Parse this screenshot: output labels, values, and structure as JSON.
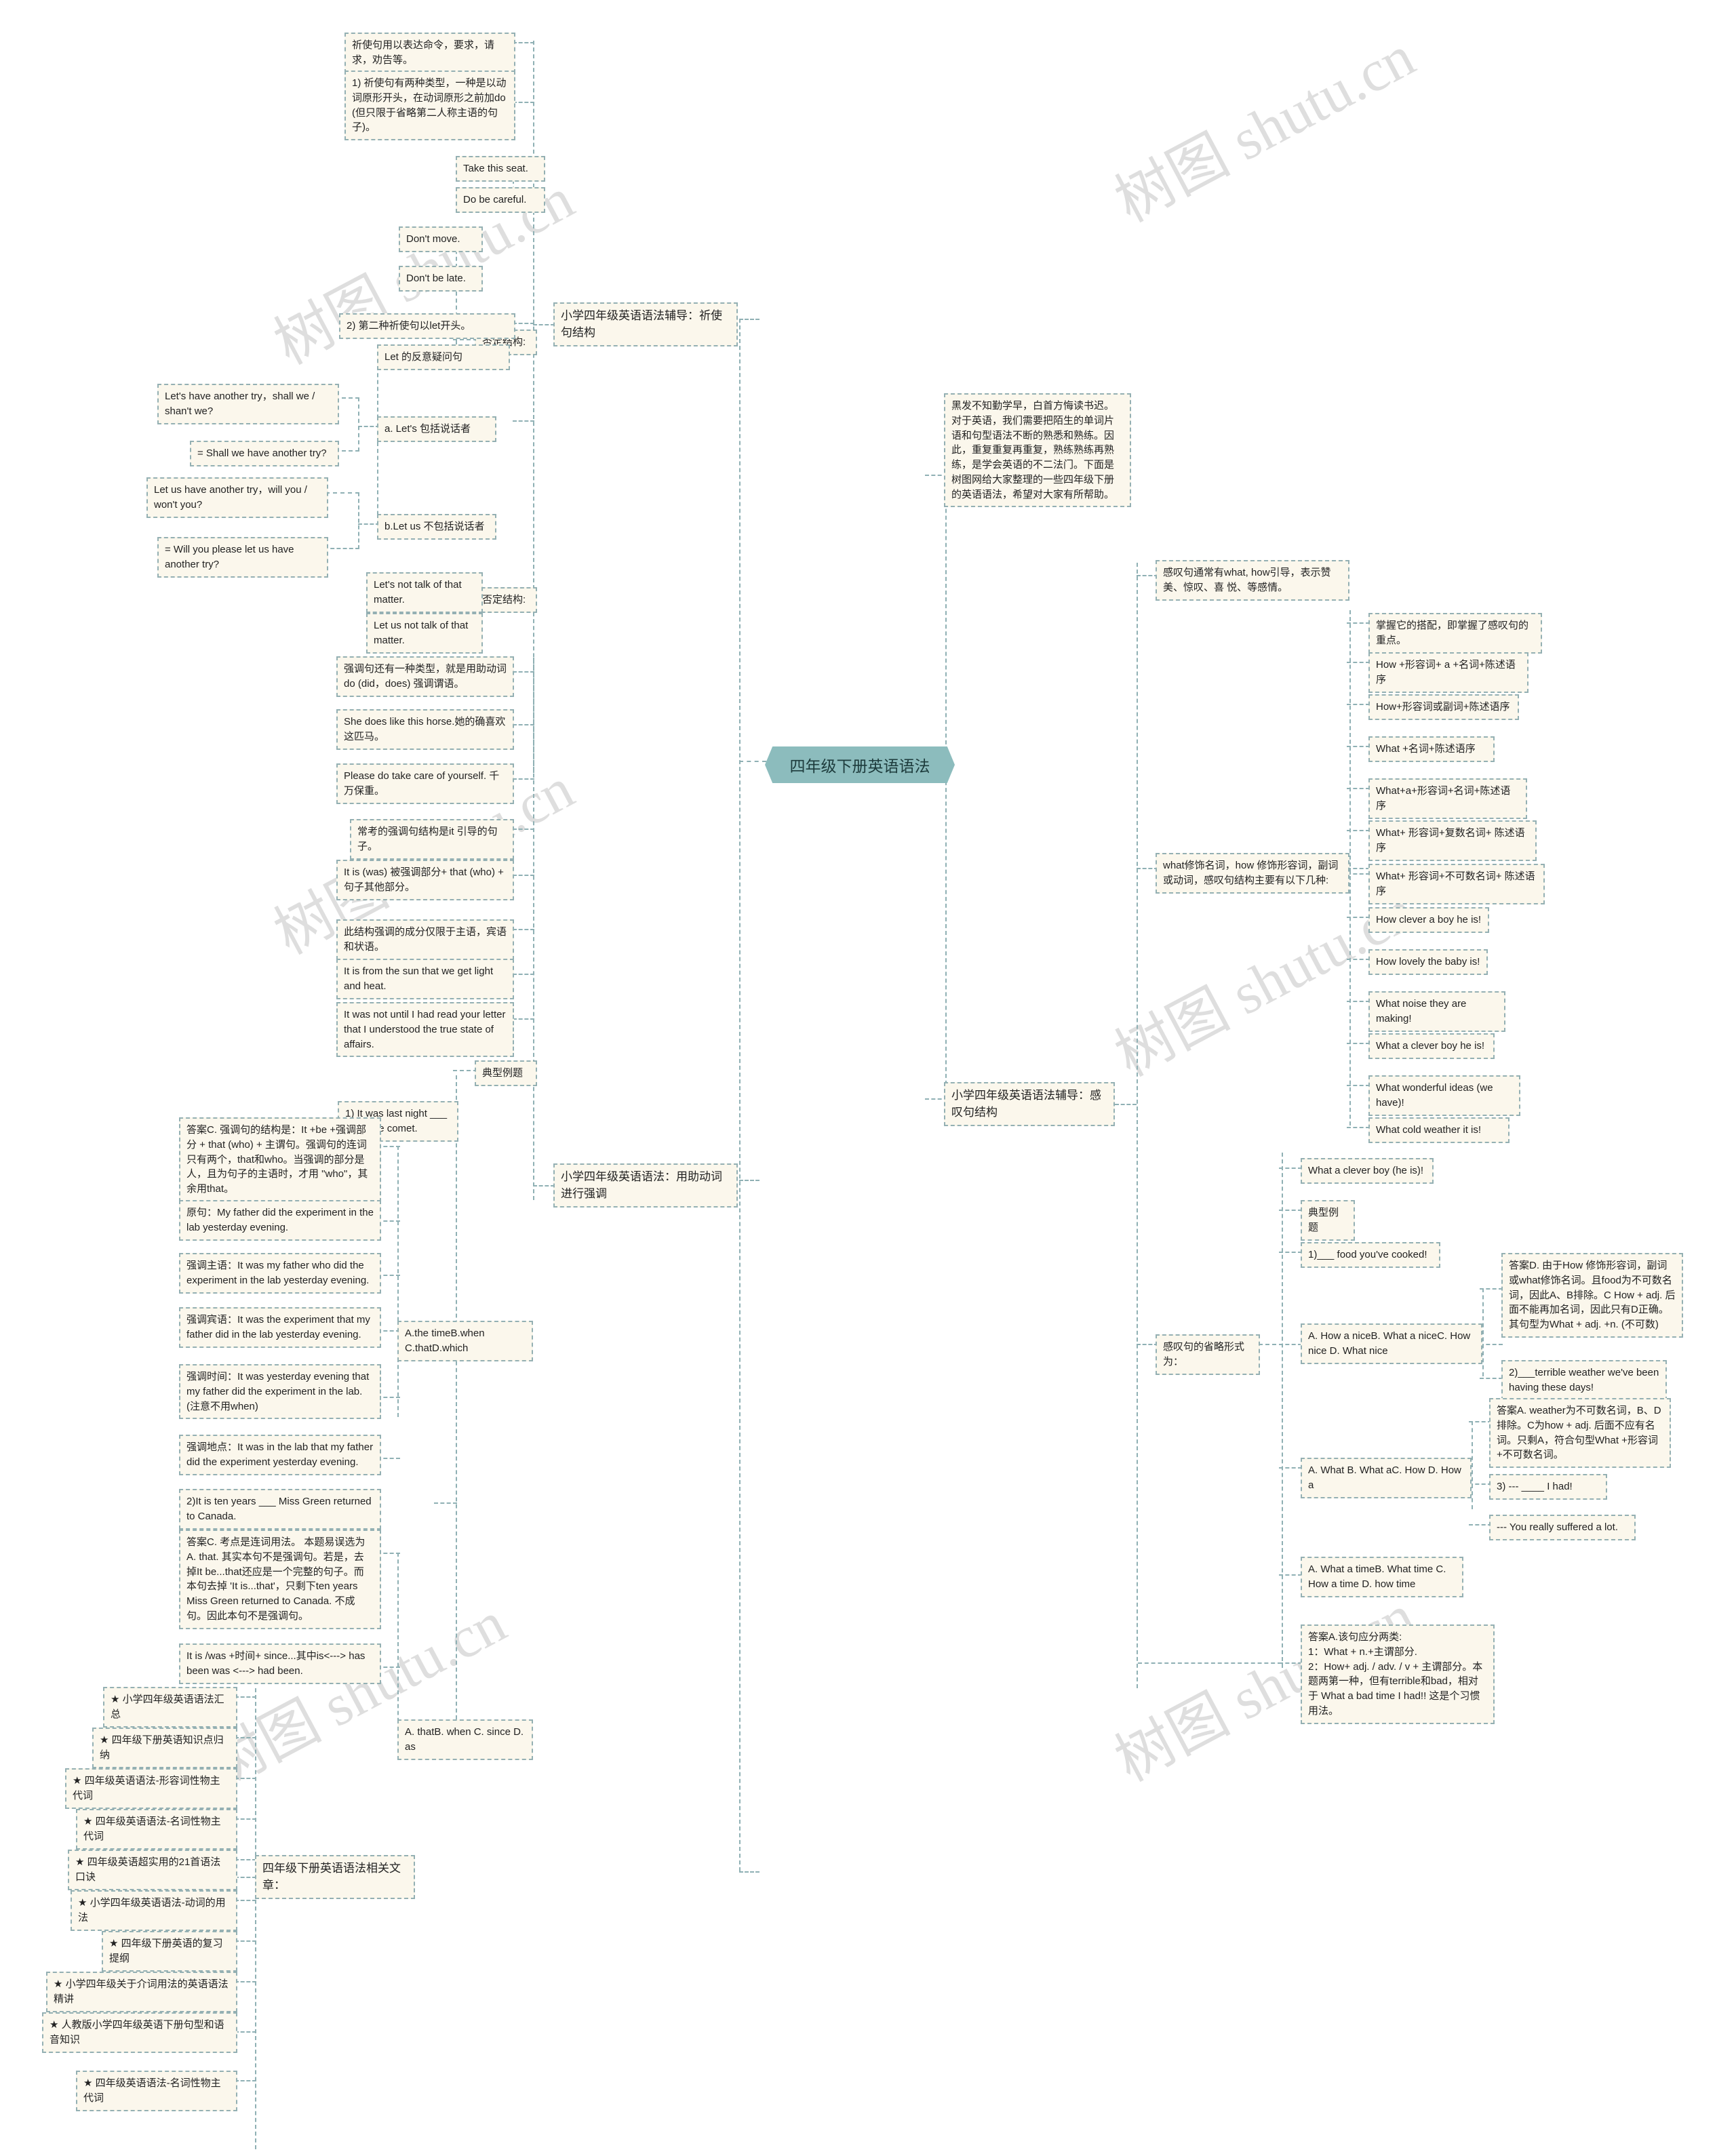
{
  "meta": {
    "watermarks": [
      "树图 shutu.cn",
      "树图 shutu.cn",
      "树图 shutu.cn",
      "树图 shutu.cn",
      "树图 shutu.cn",
      "树图 shutu.cn"
    ],
    "accent_color": "#8cbcbd",
    "node_fill": "#fbf7ec",
    "node_border": "#94b0b3"
  },
  "root": {
    "label": "四年级下册英语语法"
  },
  "intro": {
    "text": "黑发不知勤学早，白首方悔读书迟。对于英语，我们需要把陌生的单词片语和句型语法不断的熟悉和熟练。因此，重复重复再重复，熟练熟练再熟练，是学会英语的不二法门。下面是树图网给大家整理的一些四年级下册的英语语法，希望对大家有所帮助。"
  },
  "branch_imperative": {
    "title": "小学四年级英语语法辅导：祈使句结构",
    "def": "祈使句用以表达命令，要求，请求，劝告等。",
    "type1": "1) 祈使句有两种类型，一种是以动词原形开头，在动词原形之前加do (但只限于省略第二人称主语的句子)。",
    "examples1": [
      "Take this seat.",
      "Do be careful."
    ],
    "negative1_label": "否定结构:",
    "negative1": [
      "Don't move.",
      "Don't be late."
    ],
    "type2": "2) 第二种祈使句以let开头。",
    "let_tag_label": "Let 的反意疑问句",
    "lets_label": "a. Let's 包括说话者",
    "lets_examples": [
      "Let's have another try，shall we / shan't we?",
      "= Shall we have another try?"
    ],
    "letus_label": "b.Let us 不包括说话者",
    "letus_examples": [
      "Let us have another try，will you / won't you?",
      "= Will you please let us have another try?"
    ],
    "negative2_label": "否定结构:",
    "negative2": [
      "Let's not talk of that matter.",
      "Let us not talk of that matter."
    ]
  },
  "branch_emphasis": {
    "title": "小学四年级英语语法：用助动词进行强调",
    "do_rule": "强调句还有一种类型，就是用助动词do (did，does) 强调谓语。",
    "do_examples": [
      "She does like this horse.她的确喜欢这匹马。",
      "Please do take care of yourself. 千万保重。"
    ],
    "it_rule_intro": "常考的强调句结构是it 引导的句子。",
    "it_structure": "It is (was) 被强调部分+ that (who) + 句子其他部分。",
    "it_scope": "此结构强调的成分仅限于主语，宾语和状语。",
    "it_examples": [
      "It is from the sun that we get light and heat.",
      "It was not until I had read your letter that I understood the true state of affairs."
    ],
    "typical_label": "典型例题",
    "q1": "1) It was last night ___ I see the comet.",
    "q1_options": "A.the timeB.when C.thatD.which",
    "q1_answer": "答案C. 强调句的结构是：It +be +强调部分 + that (who) + 主谓句。强调句的连词只有两个，that和who。当强调的部分是人，且为句子的主语时，才用 \"who\"，其余用that。",
    "q1_orig": "原句：My father did the experiment in the lab yesterday evening.",
    "q1_subject": "强调主语：It was my father who did the experiment in the lab yesterday evening.",
    "q1_object": "强调宾语：It was the experiment that my father did in the lab yesterday evening.",
    "q1_time": "强调时间：It was yesterday evening that my father did the experiment in the lab. (注意不用when)",
    "q1_place": "强调地点：It was in the lab that my father did the experiment yesterday evening.",
    "q2": "2)It is ten years ___ Miss Green returned to Canada.",
    "q2_options": "A. thatB. when C. since D. as",
    "q2_answer": "答案C. 考点是连词用法。 本题易误选为A. that. 其实本句不是强调句。若是，去掉It be...that还应是一个完整的句子。而本句去掉 'It is...that'，只剩下ten years Miss Green returned to Canada. 不成句。因此本句不是强调句。",
    "q2_note": "It is /was +时间+ since...其中is<---> has been was <---> had been."
  },
  "branch_exclamatory": {
    "title": "小学四年级英语语法辅导：感叹句结构",
    "def": "感叹句通常有what, how引导，表示赞美、惊叹、喜 悦、等感情。",
    "key": "掌握它的搭配，即掌握了感叹句的重点。",
    "modify_rule": "what修饰名词，how 修饰形容词，副词或动词，感叹句结构主要有以下几种:",
    "structures": [
      "How +形容词+ a +名词+陈述语序",
      "How+形容词或副词+陈述语序",
      "What +名词+陈述语序",
      "What+a+形容词+名词+陈述语序",
      "What+ 形容词+复数名词+ 陈述语序",
      "What+ 形容词+不可数名词+ 陈述语序"
    ],
    "examples": [
      "How clever a boy he is!",
      "How lovely the baby is!",
      "What noise they are making!",
      "What a clever boy he is!",
      "What wonderful ideas (we have)!",
      "What cold weather it is!"
    ],
    "ellipsis_label": "感叹句的省略形式为：",
    "ellipsis_example": "What a clever boy (he is)!",
    "typical_label": "典型例题",
    "e1": "1)___ food you've cooked!",
    "e1_options": "A. How a niceB. What a niceC. How nice D. What nice",
    "e1_answer": "答案D. 由于How 修饰形容词，副词或what修饰名词。且food为不可数名词，因此A、B排除。C How + adj. 后面不能再加名词，因此只有D正确。其句型为What + adj. +n. (不可数)",
    "e2": "2)___terrible weather we've been having these days!",
    "e2_options": "A. What B. What aC. How D. How a",
    "e2_answer": "答案A. weather为不可数名词，B、D排除。C为how + adj. 后面不应有名词。只剩A，符合句型What +形容词+不可数名词。",
    "e3": "3) --- ____ I had!",
    "e3_reply": "--- You really suffered a lot.",
    "e3_options": "A. What a timeB. What time C. How a time D. how time",
    "e3_answer": "答案A.该句应分两类:\n1：What + n.+主谓部分.\n2：How+ adj. / adv. / v + 主谓部分。本题两第一种，但有terrible和bad，相对于 What a bad time I had!! 这是个习惯用法。"
  },
  "branch_related": {
    "title": "四年级下册英语语法相关文章：",
    "items": [
      "★ 小学四年级英语语法汇总",
      "★ 四年级下册英语知识点归纳",
      "★ 四年级英语语法-形容词性物主代词",
      "★ 四年级英语语法-名词性物主代词",
      "★ 四年级英语超实用的21首语法口诀",
      "★ 小学四年级英语语法-动词的用法",
      "★ 四年级下册英语的复习提纲",
      "★ 小学四年级关于介词用法的英语语法精讲",
      "★ 人教版小学四年级英语下册句型和语音知识",
      "★ 四年级英语语法-名词性物主代词"
    ]
  }
}
